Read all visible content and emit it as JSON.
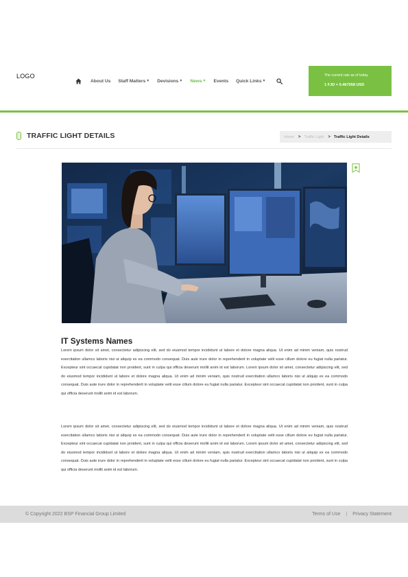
{
  "header": {
    "logo": "LOGO",
    "nav": [
      {
        "label": "About Us",
        "dropdown": false,
        "active": false
      },
      {
        "label": "Staff Matters",
        "dropdown": true,
        "active": false
      },
      {
        "label": "Devisions",
        "dropdown": true,
        "active": false
      },
      {
        "label": "News",
        "dropdown": true,
        "active": true
      },
      {
        "label": "Events",
        "dropdown": false,
        "active": false
      },
      {
        "label": "Quick Links",
        "dropdown": true,
        "active": false
      }
    ],
    "icons": {
      "home": "home-icon",
      "search": "search-icon"
    },
    "rate": {
      "label": "The current rate as of today",
      "value": "1 FJD = 0.467058 USD"
    }
  },
  "page": {
    "title": "TRAFFIC LIGHT DETAILS",
    "breadcrumb": [
      "Home",
      "Traffic Light",
      "Traffic Light Details"
    ]
  },
  "article": {
    "title": "IT Systems Names",
    "paragraphs": [
      "Lorem ipsum dolor sit amet, consectetur adipiscing elit, sed do eiusmod tempor incididunt ut labore et dolore magna aliqua. Ut enim ad minim veniam, quis nostrud exercitation ullamco laboris nisi ut aliquip ex ea commodo consequat. Duis aute irure dolor in reprehenderit in voluptate velit esse cillum dolore eu fugiat nulla pariatur. Excepteur sint occaecat cupidatat non proident, sunt in culpa qui officia deserunt mollit anim id est laborum. Lorem ipsum dolor sit amet, consectetur adipiscing elit, sed do eiusmod tempor incididunt ut labore et dolore magna aliqua. Ut enim ad minim veniam, quis nostrud exercitation ullamco laboris nisi ut aliquip ex ea commodo consequat. Duis aute irure dolor in reprehenderit in voluptate velit esse cillum dolore eu fugiat nulla pariatur. Excepteur sint occaecat cupidatat non proident, sunt in culpa qui officia deserunt mollit anim id est laborum.",
      "Lorem ipsum dolor sit amet, consectetur adipiscing elit, sed do eiusmod tempor incididunt ut labore et dolore magna aliqua. Ut enim ad minim veniam, quis nostrud exercitation ullamco laboris nisi ut aliquip ex ea commodo consequat. Duis aute irure dolor in reprehenderit in voluptate velit esse cillum dolore eu fugiat nulla pariatur. Excepteur sint occaecat cupidatat non proident, sunt in culpa qui officia deserunt mollit anim id est laborum. Lorem ipsum dolor sit amet, consectetur adipiscing elit, sed do eiusmod tempor incididunt ut labore et dolore magna aliqua. Ut enim ad minim veniam, quis nostrud exercitation ullamco laboris nisi ut aliquip ex ea commodo consequat. Duis aute irure dolor in reprehenderit in voluptate velit esse cillum dolore eu fugiat nulla pariatur. Excepteur sint occaecat cupidatat non proident, sunt in culpa qui officia deserunt mollit anim id est laborum."
    ],
    "bookmark_icon": "bookmark-star-icon"
  },
  "footer": {
    "copyright": "© Copyright 2022 BSP Financial Group Limited",
    "links": [
      "Terms of Use",
      "Privacy Statement"
    ],
    "separator": "|"
  },
  "colors": {
    "accent": "#7ac143",
    "active_nav": "#6cc04a",
    "footer_bg": "#dcdcdc"
  }
}
